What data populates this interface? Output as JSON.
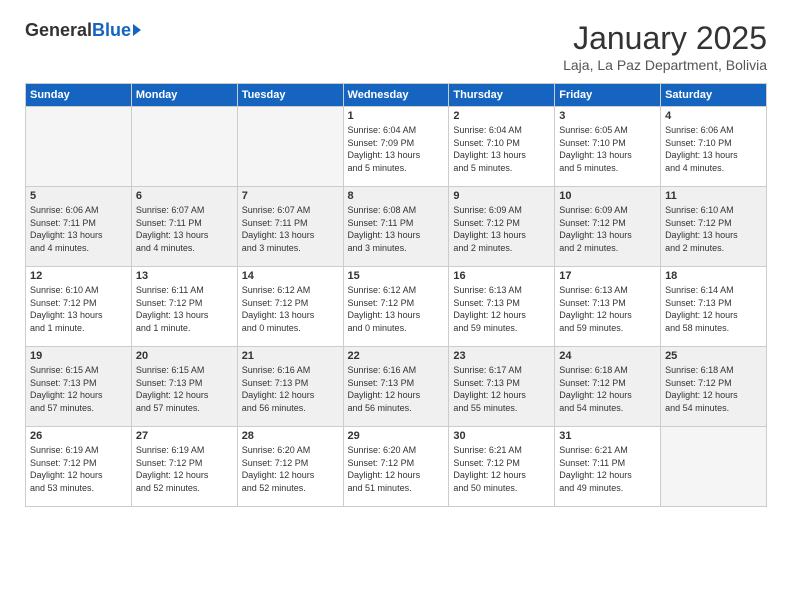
{
  "header": {
    "logo_general": "General",
    "logo_blue": "Blue",
    "month_title": "January 2025",
    "subtitle": "Laja, La Paz Department, Bolivia"
  },
  "weekdays": [
    "Sunday",
    "Monday",
    "Tuesday",
    "Wednesday",
    "Thursday",
    "Friday",
    "Saturday"
  ],
  "weeks": [
    [
      {
        "day": "",
        "info": ""
      },
      {
        "day": "",
        "info": ""
      },
      {
        "day": "",
        "info": ""
      },
      {
        "day": "1",
        "info": "Sunrise: 6:04 AM\nSunset: 7:09 PM\nDaylight: 13 hours\nand 5 minutes."
      },
      {
        "day": "2",
        "info": "Sunrise: 6:04 AM\nSunset: 7:10 PM\nDaylight: 13 hours\nand 5 minutes."
      },
      {
        "day": "3",
        "info": "Sunrise: 6:05 AM\nSunset: 7:10 PM\nDaylight: 13 hours\nand 5 minutes."
      },
      {
        "day": "4",
        "info": "Sunrise: 6:06 AM\nSunset: 7:10 PM\nDaylight: 13 hours\nand 4 minutes."
      }
    ],
    [
      {
        "day": "5",
        "info": "Sunrise: 6:06 AM\nSunset: 7:11 PM\nDaylight: 13 hours\nand 4 minutes."
      },
      {
        "day": "6",
        "info": "Sunrise: 6:07 AM\nSunset: 7:11 PM\nDaylight: 13 hours\nand 4 minutes."
      },
      {
        "day": "7",
        "info": "Sunrise: 6:07 AM\nSunset: 7:11 PM\nDaylight: 13 hours\nand 3 minutes."
      },
      {
        "day": "8",
        "info": "Sunrise: 6:08 AM\nSunset: 7:11 PM\nDaylight: 13 hours\nand 3 minutes."
      },
      {
        "day": "9",
        "info": "Sunrise: 6:09 AM\nSunset: 7:12 PM\nDaylight: 13 hours\nand 2 minutes."
      },
      {
        "day": "10",
        "info": "Sunrise: 6:09 AM\nSunset: 7:12 PM\nDaylight: 13 hours\nand 2 minutes."
      },
      {
        "day": "11",
        "info": "Sunrise: 6:10 AM\nSunset: 7:12 PM\nDaylight: 13 hours\nand 2 minutes."
      }
    ],
    [
      {
        "day": "12",
        "info": "Sunrise: 6:10 AM\nSunset: 7:12 PM\nDaylight: 13 hours\nand 1 minute."
      },
      {
        "day": "13",
        "info": "Sunrise: 6:11 AM\nSunset: 7:12 PM\nDaylight: 13 hours\nand 1 minute."
      },
      {
        "day": "14",
        "info": "Sunrise: 6:12 AM\nSunset: 7:12 PM\nDaylight: 13 hours\nand 0 minutes."
      },
      {
        "day": "15",
        "info": "Sunrise: 6:12 AM\nSunset: 7:12 PM\nDaylight: 13 hours\nand 0 minutes."
      },
      {
        "day": "16",
        "info": "Sunrise: 6:13 AM\nSunset: 7:13 PM\nDaylight: 12 hours\nand 59 minutes."
      },
      {
        "day": "17",
        "info": "Sunrise: 6:13 AM\nSunset: 7:13 PM\nDaylight: 12 hours\nand 59 minutes."
      },
      {
        "day": "18",
        "info": "Sunrise: 6:14 AM\nSunset: 7:13 PM\nDaylight: 12 hours\nand 58 minutes."
      }
    ],
    [
      {
        "day": "19",
        "info": "Sunrise: 6:15 AM\nSunset: 7:13 PM\nDaylight: 12 hours\nand 57 minutes."
      },
      {
        "day": "20",
        "info": "Sunrise: 6:15 AM\nSunset: 7:13 PM\nDaylight: 12 hours\nand 57 minutes."
      },
      {
        "day": "21",
        "info": "Sunrise: 6:16 AM\nSunset: 7:13 PM\nDaylight: 12 hours\nand 56 minutes."
      },
      {
        "day": "22",
        "info": "Sunrise: 6:16 AM\nSunset: 7:13 PM\nDaylight: 12 hours\nand 56 minutes."
      },
      {
        "day": "23",
        "info": "Sunrise: 6:17 AM\nSunset: 7:13 PM\nDaylight: 12 hours\nand 55 minutes."
      },
      {
        "day": "24",
        "info": "Sunrise: 6:18 AM\nSunset: 7:12 PM\nDaylight: 12 hours\nand 54 minutes."
      },
      {
        "day": "25",
        "info": "Sunrise: 6:18 AM\nSunset: 7:12 PM\nDaylight: 12 hours\nand 54 minutes."
      }
    ],
    [
      {
        "day": "26",
        "info": "Sunrise: 6:19 AM\nSunset: 7:12 PM\nDaylight: 12 hours\nand 53 minutes."
      },
      {
        "day": "27",
        "info": "Sunrise: 6:19 AM\nSunset: 7:12 PM\nDaylight: 12 hours\nand 52 minutes."
      },
      {
        "day": "28",
        "info": "Sunrise: 6:20 AM\nSunset: 7:12 PM\nDaylight: 12 hours\nand 52 minutes."
      },
      {
        "day": "29",
        "info": "Sunrise: 6:20 AM\nSunset: 7:12 PM\nDaylight: 12 hours\nand 51 minutes."
      },
      {
        "day": "30",
        "info": "Sunrise: 6:21 AM\nSunset: 7:12 PM\nDaylight: 12 hours\nand 50 minutes."
      },
      {
        "day": "31",
        "info": "Sunrise: 6:21 AM\nSunset: 7:11 PM\nDaylight: 12 hours\nand 49 minutes."
      },
      {
        "day": "",
        "info": ""
      }
    ]
  ]
}
